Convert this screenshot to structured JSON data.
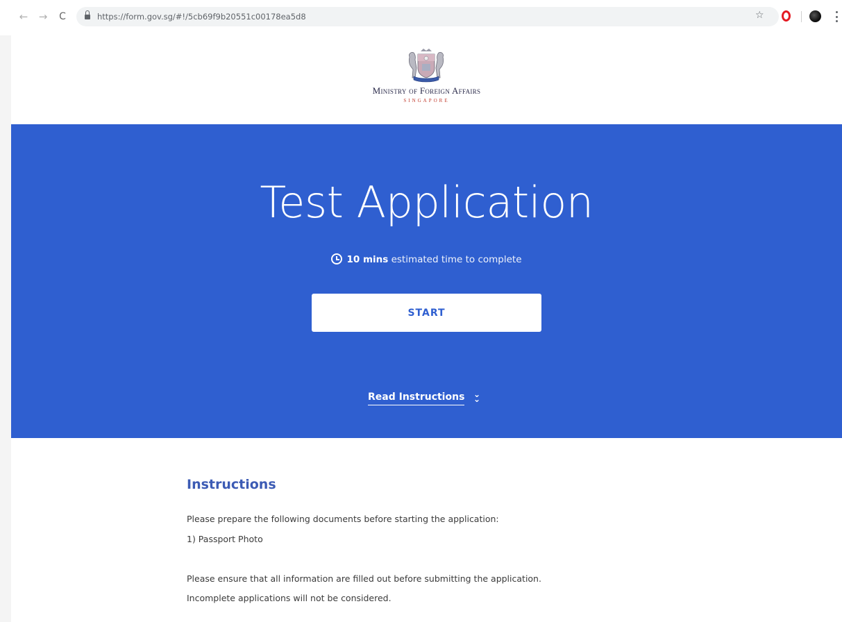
{
  "browser": {
    "url": "https://form.gov.sg/#!/5cb69f9b20551c00178ea5d8"
  },
  "header": {
    "ministry_name": "Ministry of Foreign Affairs",
    "ministry_country": "SINGAPORE"
  },
  "hero": {
    "title": "Test Application",
    "estimate_bold": "10 mins",
    "estimate_rest": " estimated time to complete",
    "start_label": "START",
    "read_instructions_label": "Read Instructions",
    "background_color": "#2f5fd0"
  },
  "instructions": {
    "title": "Instructions",
    "lines": [
      "Please prepare the following documents before starting the application:",
      "1) Passport Photo",
      "Please ensure that all information are filled out before submitting the application.",
      "Incomplete applications will not be considered."
    ]
  }
}
